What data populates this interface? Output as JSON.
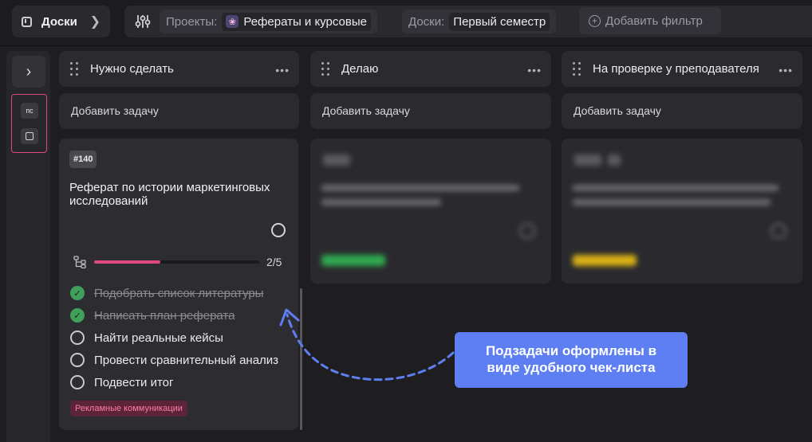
{
  "topbar": {
    "board_label": "Доски",
    "filters": [
      {
        "key": "Проекты:",
        "value": "Рефераты и курсовые",
        "icon": "project-flower-icon"
      },
      {
        "key": "Доски:",
        "value": "Первый семестр"
      }
    ],
    "add_filter_label": "Добавить фильтр"
  },
  "sidebar": {
    "items": [
      {
        "label": "пс"
      },
      {
        "icon": "board-square-icon"
      }
    ],
    "accent_color": "#e0497e"
  },
  "columns": [
    {
      "title": "Нужно сделать",
      "add_task_label": "Добавить задачу"
    },
    {
      "title": "Делаю",
      "add_task_label": "Добавить задачу"
    },
    {
      "title": "На проверке у преподавателя",
      "add_task_label": "Добавить задачу"
    }
  ],
  "card": {
    "id": "#140",
    "title": "Реферат по истории маркетинговых исследований",
    "progress": {
      "done": 2,
      "total": 5,
      "text": "2/5"
    },
    "subtasks": [
      {
        "text": "Подобрать список литературы",
        "done": true
      },
      {
        "text": "Написать план реферата",
        "done": true
      },
      {
        "text": "Найти реальные кейсы",
        "done": false
      },
      {
        "text": "Провести сравнительный анализ",
        "done": false
      },
      {
        "text": "Подвести итог",
        "done": false
      }
    ],
    "tag": "Рекламные коммуникации",
    "tag_color": "#ff7ba8"
  },
  "ghost_cards": [
    {
      "tag_color": "#2fa84f"
    },
    {
      "tag_color": "#d8b015"
    }
  ],
  "callout": {
    "line1": "Подзадачи оформлены в",
    "line2": "виде удобного чек-листа",
    "color": "#5d7ff2"
  }
}
